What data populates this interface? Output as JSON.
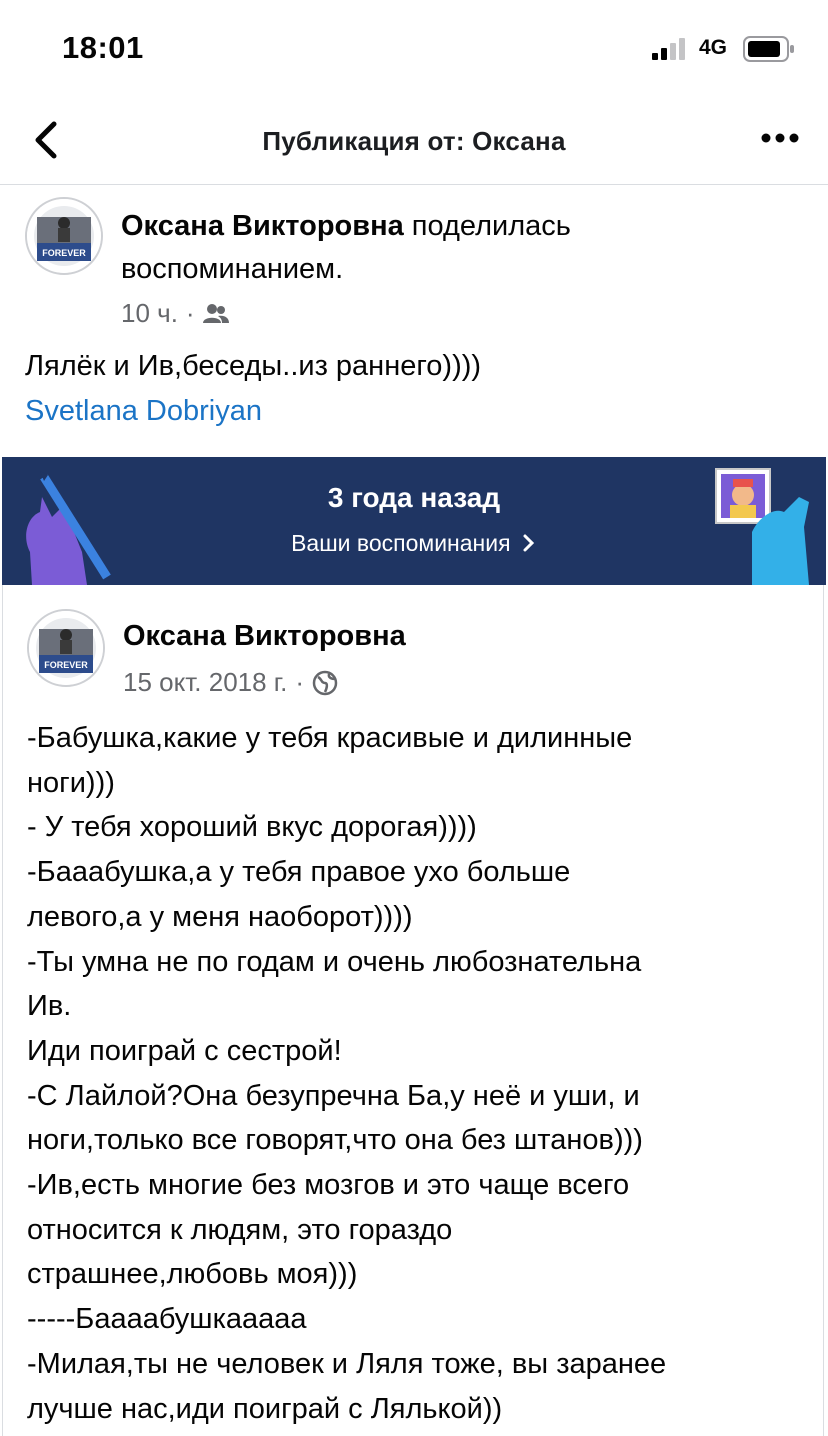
{
  "status_bar": {
    "time": "18:01",
    "network": "4G"
  },
  "nav": {
    "title": "Публикация от: Оксана"
  },
  "shared_post": {
    "author": "Оксана Викторовна",
    "action_line1": " поделилась",
    "action_line2": "воспоминанием.",
    "time": "10 ч.",
    "dot": "·",
    "audience_icon": "friends-icon",
    "text": "Лялёк и Ив,беседы..из раннего))))",
    "tagged_user": "Svetlana Dobriyan"
  },
  "memory": {
    "title": "3 года назад",
    "subtitle": "Ваши воспоминания",
    "colors": {
      "banner_bg": "#1f3563",
      "left_hand": "#7b5cd6",
      "right_hand": "#33b0e8"
    }
  },
  "original_post": {
    "author": "Оксана Викторовна",
    "date": "15 окт. 2018 г.",
    "dot": "·",
    "audience_icon": "globe-icon",
    "lines": [
      "-Бабушка,какие у тебя красивые и дилинные",
      "ноги)))",
      "- У тебя хороший вкус дорогая))))",
      "-Бааабушка,а у тебя правое ухо больше",
      "левого,а у меня наоборот))))",
      "-Ты умна не по годам и очень любознательна",
      "Ив.",
      "Иди поиграй с сестрой!",
      "-С Лайлой?Она безупречна Ба,у неё и уши, и",
      "ноги,только все говорят,что она без штанов)))",
      "-Ив,есть многие без мозгов и это чаще всего",
      "относится к людям, это гораздо",
      "страшнее,любовь моя)))",
      "-----Баааабушкааааа",
      "-Милая,ты не человек и Ляля тоже, вы заранее",
      "лучше нас,иди поиграй с Лялькой))"
    ]
  },
  "avatar_badge": "FOREVER"
}
